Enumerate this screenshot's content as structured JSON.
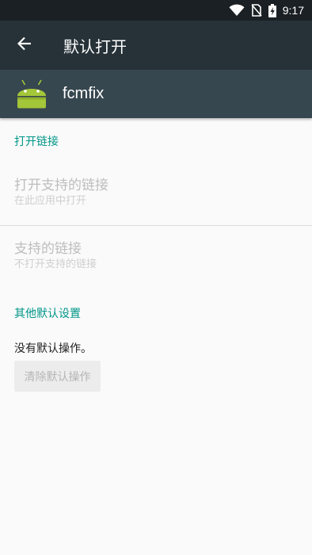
{
  "status_bar": {
    "time": "9:17",
    "icons": [
      "wifi-icon",
      "no-sim-icon",
      "battery-charging-icon"
    ]
  },
  "toolbar": {
    "back_icon": "arrow-left-icon",
    "title": "默认打开"
  },
  "app": {
    "icon": "android-icon",
    "name": "fcmfix"
  },
  "sections": {
    "open_links": {
      "header": "打开链接",
      "open_supported": {
        "title": "打开支持的链接",
        "summary": "在此应用中打开"
      },
      "supported_links": {
        "title": "支持的链接",
        "summary": "不打开支持的链接"
      }
    },
    "other_defaults": {
      "header": "其他默认设置",
      "message": "没有默认操作。",
      "clear_button": "清除默认操作"
    }
  },
  "colors": {
    "toolbar": "#263238",
    "app_header": "#37474f",
    "accent": "#009688",
    "android_green": "#a4c639"
  }
}
